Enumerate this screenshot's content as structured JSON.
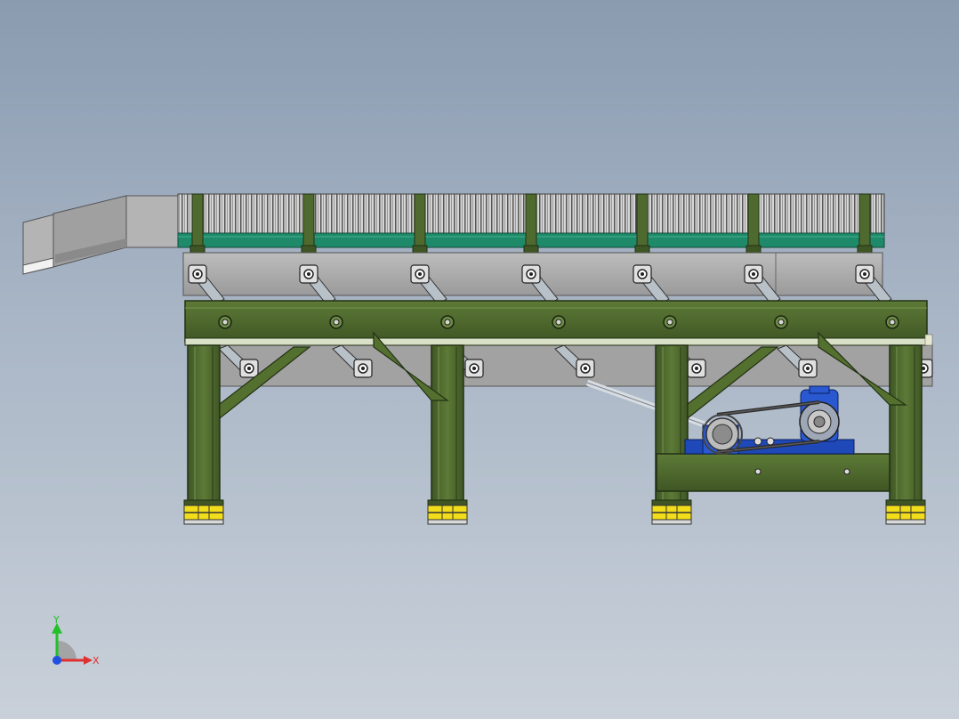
{
  "viewport": {
    "background_top": "#8a9bb0",
    "background_bottom": "#c9d0d9"
  },
  "model": {
    "frame_color": "#4f6a2e",
    "frame_dark": "#2f4219",
    "trough_color": "#a9a9a9",
    "belt_color": "#1f8a6a",
    "foot_color": "#f2dd1a",
    "motor_color": "#1f48b8"
  },
  "triad": {
    "x_label": "X",
    "y_label": "Y",
    "x_color": "#e03030",
    "y_color": "#22c02a",
    "z_color": "#2050e0"
  }
}
